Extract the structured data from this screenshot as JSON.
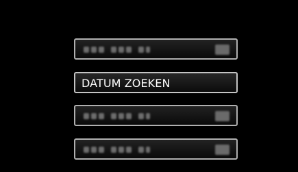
{
  "menu": {
    "items": [
      {
        "label": "",
        "state": "unreadable"
      },
      {
        "label": "DATUM ZOEKEN",
        "state": "readable"
      },
      {
        "label": "",
        "state": "unreadable"
      },
      {
        "label": "",
        "state": "unreadable"
      }
    ]
  },
  "colors": {
    "background": "#000000",
    "item_border": "#b0b0b0",
    "item_text": "#ffffff",
    "placeholder": "#6d6d6d"
  },
  "icons": {
    "placeholder_icon": "blurred-block-icon"
  }
}
